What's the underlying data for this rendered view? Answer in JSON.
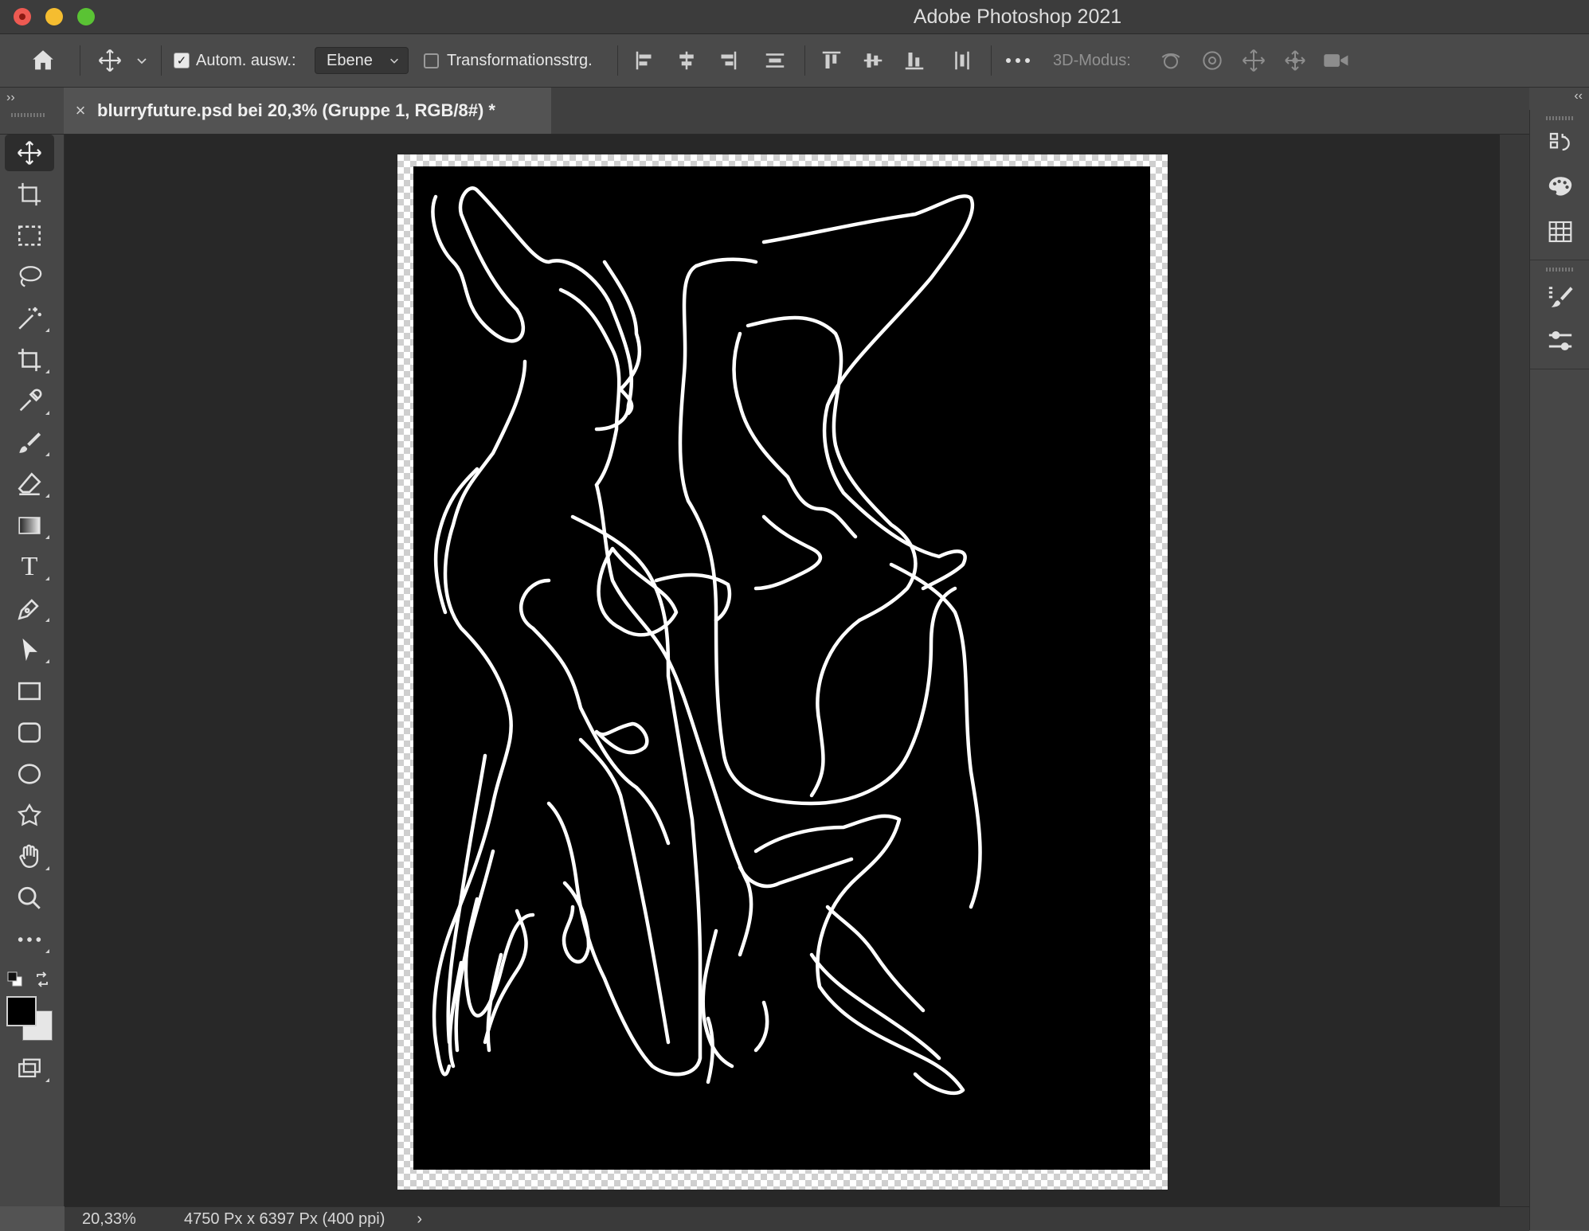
{
  "window": {
    "title": "Adobe Photoshop 2021"
  },
  "options_bar": {
    "auto_select_label": "Autom. ausw.:",
    "auto_select_checked": true,
    "auto_select_target": "Ebene",
    "transform_controls_label": "Transformationsstrg.",
    "transform_controls_checked": false,
    "mode_3d_label": "3D-Modus:"
  },
  "document": {
    "tab_title": "blurryfuture.psd bei 20,3% (Gruppe 1, RGB/8#) *",
    "tab_close_glyph": "×"
  },
  "tools": [
    {
      "name": "move-tool",
      "icon": "move-icon",
      "active": true
    },
    {
      "name": "artboard-tool",
      "icon": "artboard-icon"
    },
    {
      "name": "marquee-tool",
      "icon": "rect-marquee-icon"
    },
    {
      "name": "lasso-tool",
      "icon": "lasso-icon"
    },
    {
      "name": "magic-wand-tool",
      "icon": "magic-wand-icon"
    },
    {
      "name": "crop-tool",
      "icon": "crop-icon"
    },
    {
      "name": "eyedropper-tool",
      "icon": "eyedropper-icon"
    },
    {
      "name": "brush-tool",
      "icon": "brush-icon"
    },
    {
      "name": "eraser-tool",
      "icon": "eraser-icon"
    },
    {
      "name": "gradient-tool",
      "icon": "gradient-icon"
    },
    {
      "name": "type-tool",
      "icon": "type-icon",
      "glyph": "T"
    },
    {
      "name": "pen-tool",
      "icon": "pen-icon"
    },
    {
      "name": "path-select-tool",
      "icon": "arrow-icon"
    },
    {
      "name": "rectangle-tool",
      "icon": "rectangle-icon"
    },
    {
      "name": "rounded-rect-tool",
      "icon": "rounded-rect-icon"
    },
    {
      "name": "ellipse-tool",
      "icon": "ellipse-icon"
    },
    {
      "name": "custom-shape-tool",
      "icon": "custom-shape-icon"
    },
    {
      "name": "hand-tool",
      "icon": "hand-icon"
    },
    {
      "name": "zoom-tool",
      "icon": "zoom-icon"
    },
    {
      "name": "more-tools",
      "icon": "more-icon"
    }
  ],
  "colors": {
    "foreground": "#000000",
    "background": "#e6e6e6"
  },
  "status_bar": {
    "zoom": "20,33%",
    "doc_size": "4750 Px x 6397 Px (400 ppi)",
    "arrow": "›"
  }
}
